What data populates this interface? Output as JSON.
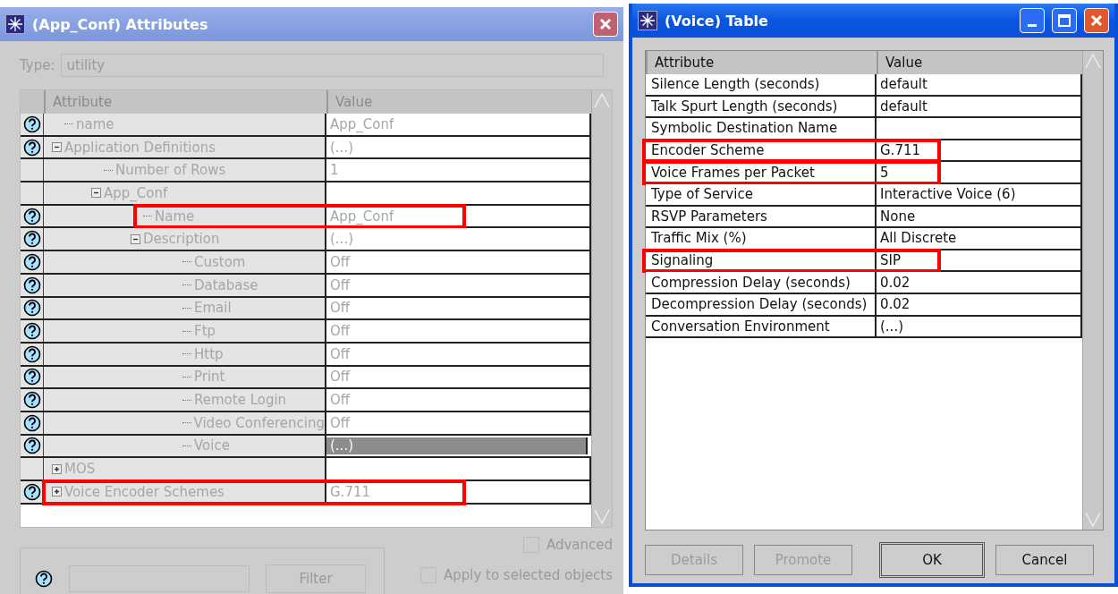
{
  "left_window": {
    "title": "(App_Conf) Attributes",
    "type_label": "Type:",
    "type_value": "utility",
    "columns": [
      "Attribute",
      "Value"
    ],
    "tree": [
      {
        "label": "name",
        "value": "App_Conf",
        "help": true,
        "selected": false,
        "highlighted": false
      },
      {
        "label": "Application Definitions",
        "value": "(...)",
        "help": true,
        "selected": false,
        "highlighted": false,
        "expanded": true,
        "children": [
          {
            "label": "Number of Rows",
            "value": "1",
            "help": false,
            "selected": false,
            "highlighted": false
          },
          {
            "label": "App_Conf",
            "help": false,
            "selected": false,
            "highlighted": false,
            "expanded": true,
            "children": [
              {
                "label": "Name",
                "value": "App_Conf",
                "help": true,
                "selected": false,
                "highlighted": true
              },
              {
                "label": "Description",
                "value": "(...)",
                "help": true,
                "selected": false,
                "highlighted": false,
                "expanded": true,
                "children": [
                  {
                    "label": "Custom",
                    "value": "Off",
                    "help": true,
                    "selected": false,
                    "highlighted": false
                  },
                  {
                    "label": "Database",
                    "value": "Off",
                    "help": true,
                    "selected": false,
                    "highlighted": false
                  },
                  {
                    "label": "Email",
                    "value": "Off",
                    "help": true,
                    "selected": false,
                    "highlighted": false
                  },
                  {
                    "label": "Ftp",
                    "value": "Off",
                    "help": true,
                    "selected": false,
                    "highlighted": false
                  },
                  {
                    "label": "Http",
                    "value": "Off",
                    "help": true,
                    "selected": false,
                    "highlighted": false
                  },
                  {
                    "label": "Print",
                    "value": "Off",
                    "help": true,
                    "selected": false,
                    "highlighted": false
                  },
                  {
                    "label": "Remote Login",
                    "value": "Off",
                    "help": true,
                    "selected": false,
                    "highlighted": false
                  },
                  {
                    "label": "Video Conferencing",
                    "value": "Off",
                    "help": true,
                    "selected": false,
                    "highlighted": false
                  },
                  {
                    "label": "Voice",
                    "value": "(...)",
                    "help": true,
                    "selected": true,
                    "highlighted": false
                  }
                ]
              }
            ]
          }
        ]
      },
      {
        "label": "MOS",
        "help": false,
        "selected": false,
        "highlighted": false,
        "expanded": false
      },
      {
        "label": "Voice Encoder Schemes",
        "value": "G.711",
        "help": true,
        "selected": false,
        "highlighted": true,
        "expanded": false
      }
    ],
    "advanced": {
      "label": "Advanced",
      "checked": false
    },
    "filter_button": "Filter",
    "apply": {
      "label": "Apply to selected objects",
      "checked": false
    }
  },
  "right_window": {
    "title": "(Voice) Table",
    "columns": [
      "Attribute",
      "Value"
    ],
    "rows": [
      {
        "attribute": "Silence Length (seconds)",
        "value": "default",
        "highlighted": false
      },
      {
        "attribute": "Talk Spurt Length (seconds)",
        "value": "default",
        "highlighted": false
      },
      {
        "attribute": "Symbolic Destination Name",
        "value": "",
        "highlighted": false
      },
      {
        "attribute": "Encoder Scheme",
        "value": "G.711",
        "highlighted": true
      },
      {
        "attribute": "Voice Frames per Packet",
        "value": "5",
        "highlighted": true
      },
      {
        "attribute": "Type of Service",
        "value": "Interactive Voice (6)",
        "highlighted": false
      },
      {
        "attribute": "RSVP Parameters",
        "value": "None",
        "highlighted": false
      },
      {
        "attribute": "Traffic Mix (%)",
        "value": "All Discrete",
        "highlighted": false
      },
      {
        "attribute": "Signaling",
        "value": "SIP",
        "highlighted": true
      },
      {
        "attribute": "Compression Delay (seconds)",
        "value": "0.02",
        "highlighted": false
      },
      {
        "attribute": "Decompression Delay (seconds)",
        "value": "0.02",
        "highlighted": false
      },
      {
        "attribute": "Conversation Environment",
        "value": "(...)",
        "highlighted": false
      }
    ],
    "buttons": [
      {
        "label": "Details",
        "disabled": true,
        "default": false
      },
      {
        "label": "Promote",
        "disabled": true,
        "default": false
      },
      {
        "label": "OK",
        "disabled": false,
        "default": true
      },
      {
        "label": "Cancel",
        "disabled": false,
        "default": false
      }
    ]
  }
}
